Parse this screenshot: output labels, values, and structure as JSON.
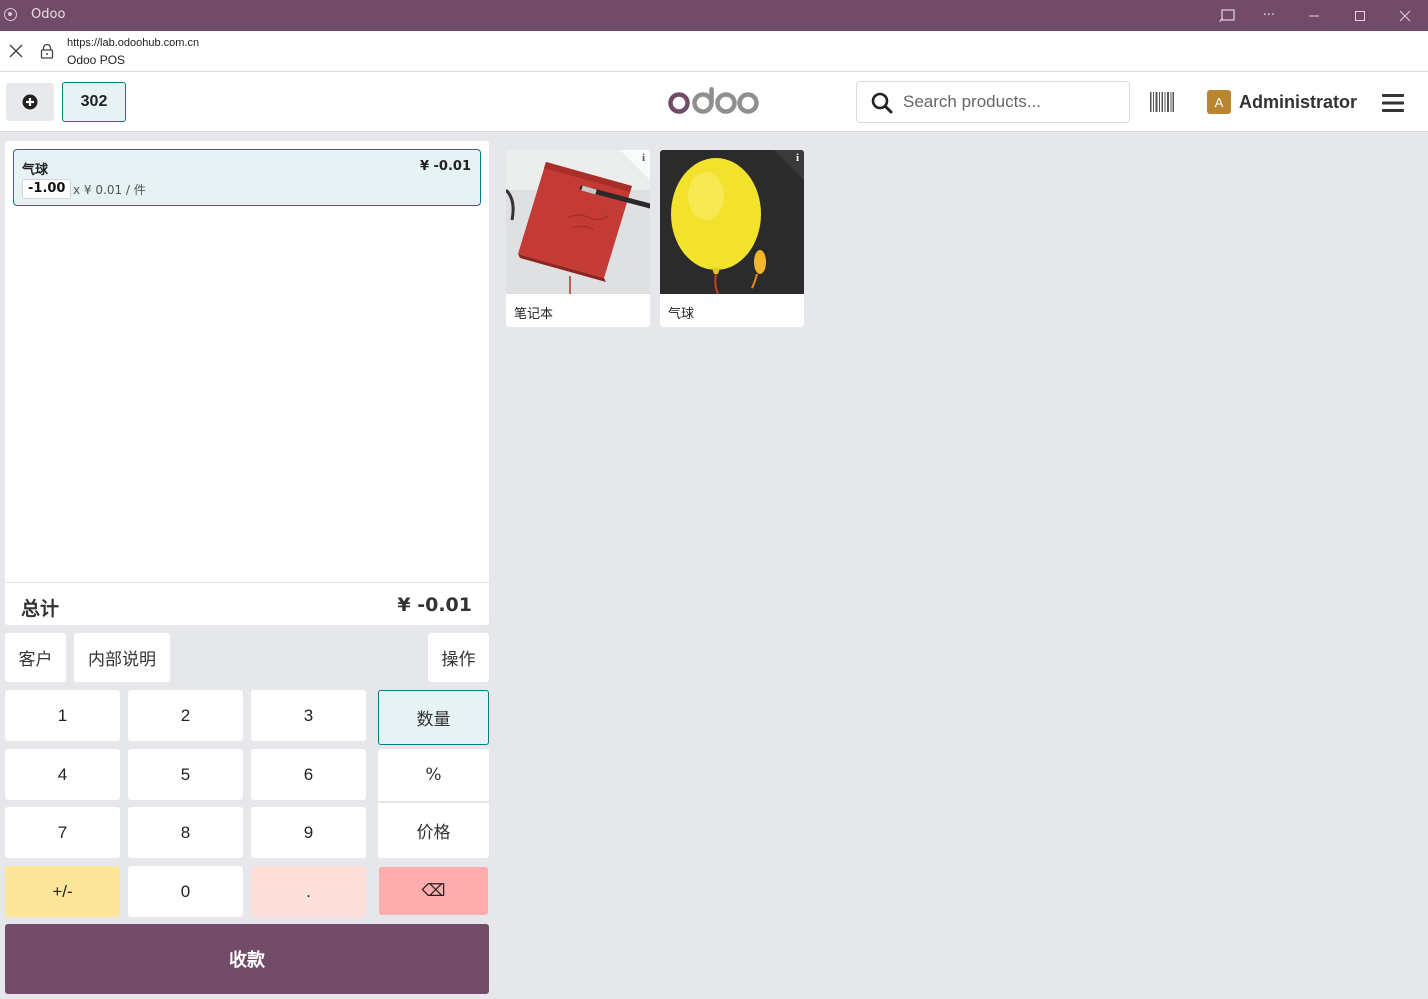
{
  "window": {
    "title": "Odoo",
    "url": "https://lab.odoohub.com.cn",
    "page_title": "Odoo POS"
  },
  "header": {
    "order_number": "302",
    "logo_text": "odoo",
    "search_placeholder": "Search products...",
    "avatar_letter": "A",
    "user_name": "Administrator"
  },
  "order": {
    "lines": [
      {
        "name": "气球",
        "price": "¥ -0.01",
        "qty": "-1.00",
        "unit_price": "x ¥ 0.01 / 件"
      }
    ],
    "total_label": "总计",
    "total_value": "¥ -0.01"
  },
  "controls": {
    "customer": "客户",
    "internal_note": "内部说明",
    "actions": "操作"
  },
  "numpad": {
    "keys": [
      "1",
      "2",
      "3",
      "4",
      "5",
      "6",
      "7",
      "8",
      "9",
      "+/-",
      "0",
      "."
    ],
    "modes": [
      "数量",
      "%",
      "价格"
    ],
    "backspace": "⌫",
    "active_mode": "数量"
  },
  "payment_label": "收款",
  "products": [
    {
      "name": "笔记本",
      "icon": "notebook-image"
    },
    {
      "name": "气球",
      "icon": "balloon-image"
    }
  ],
  "colors": {
    "brand": "#714b67",
    "accent": "#017e84",
    "selected_bg": "#e6f2f3",
    "plusminus": "#fde69a",
    "dot": "#fce0d9",
    "backspace": "#ffacae"
  }
}
